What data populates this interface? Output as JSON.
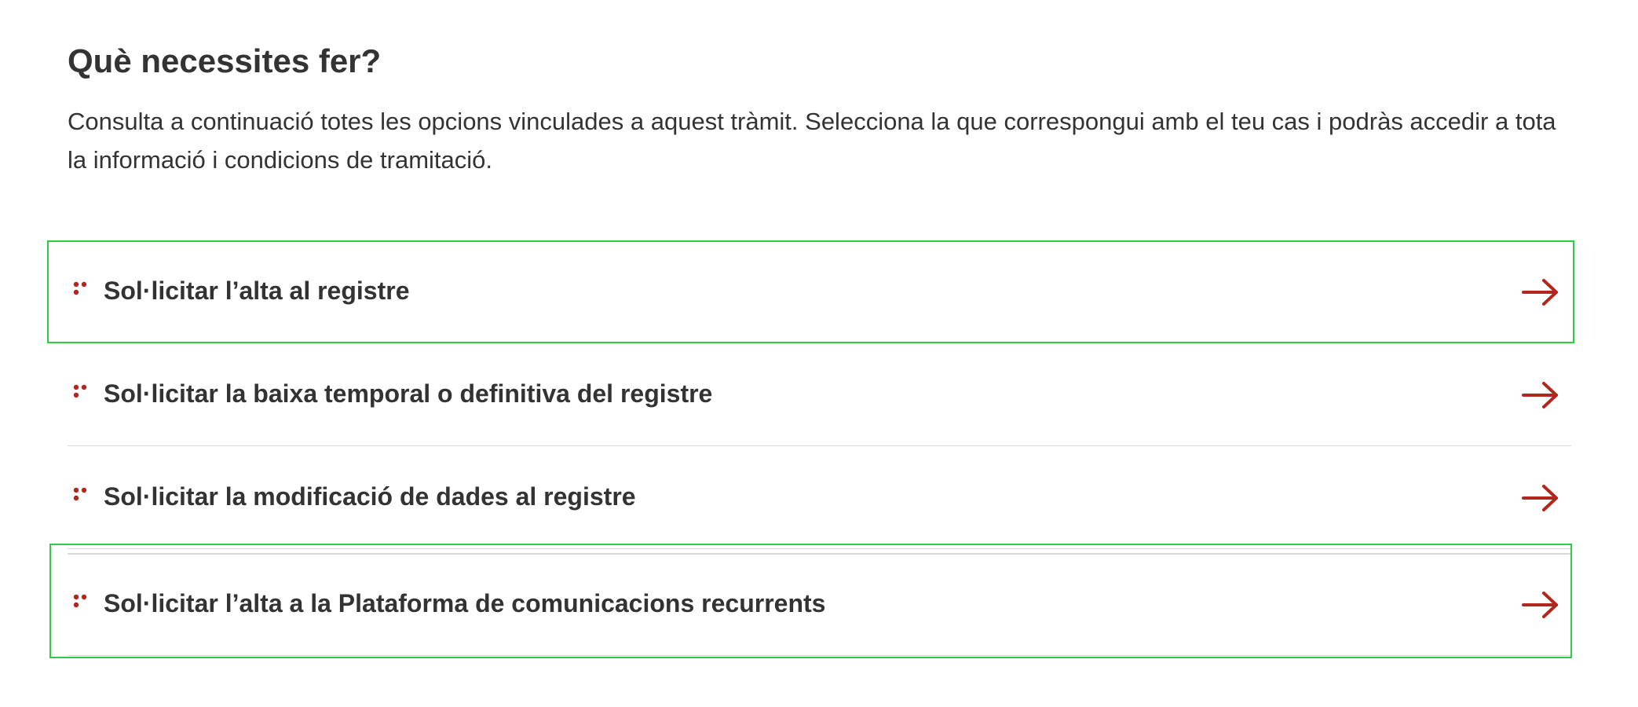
{
  "page": {
    "heading": "Què necessites fer?",
    "intro": "Consulta a continuació totes les opcions vinculades a aquest tràmit. Selecciona la que correspongui amb el teu cas i podràs accedir a tota la informació i condicions de tramitació."
  },
  "options": [
    {
      "label": "Sol·licitar l’alta al registre",
      "icon": "bullet-dots-icon",
      "action_icon": "arrow-right-icon"
    },
    {
      "label": "Sol·licitar la baixa temporal o definitiva del registre",
      "icon": "bullet-dots-icon",
      "action_icon": "arrow-right-icon"
    },
    {
      "label": "Sol·licitar la modificació de dades al registre",
      "icon": "bullet-dots-icon",
      "action_icon": "arrow-right-icon"
    },
    {
      "label": "Sol·licitar l’alta a la Plataforma de comunicacions recurrents",
      "icon": "bullet-dots-icon",
      "action_icon": "arrow-right-icon"
    }
  ],
  "colors": {
    "accent": "#b3261e",
    "text": "#333333",
    "divider": "#d9d9d9",
    "focus_highlight": "#2ecc40"
  }
}
